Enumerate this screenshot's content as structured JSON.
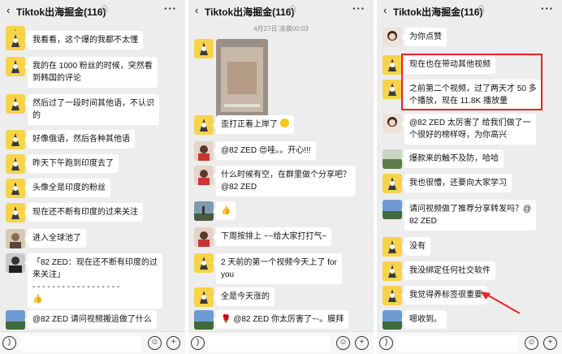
{
  "colors": {
    "bubble": "#ffffff",
    "chat_bg": "#ededed",
    "highlight": "#e8232b"
  },
  "screens": [
    {
      "title": "Tiktok出海掘金(116)",
      "messages": [
        {
          "text": ""
        },
        {
          "text": "我看看，这个爆的我都不太懂"
        },
        {
          "text": "我的在 1000 粉丝的时候，突然看\n到韩国的评论"
        },
        {
          "text": "然后过了一段时间其他语，不认识\n的"
        },
        {
          "text": "好像俄语，然后各种其他语"
        },
        {
          "text": "昨天下午跑到印度去了"
        },
        {
          "text": "头像全是印度的粉丝"
        },
        {
          "text": "现在还不断有印度的过来关注"
        },
        {
          "text": "进入全球池了"
        },
        {
          "text": "「82 ZED：现在还不断有印度的过\n来关注」\n- - - - - - - - - - - - - - - - - -\n👍"
        },
        {
          "text": "@82 ZED 请问视频搬运做了什么"
        }
      ]
    },
    {
      "title": "Tiktok出海掘金(116)",
      "timestamp": "4月27日 凌晨00:03",
      "messages": [
        {
          "text": "歪打正着上岸了"
        },
        {
          "text": "@82 ZED 😍哇。。开心!!!"
        },
        {
          "text": "什么时候有空，在群里做个分享吧？\n@82 ZED"
        },
        {
          "text": "👍"
        },
        {
          "text": "下周按排上 ~~给大家打打气~"
        },
        {
          "text": "2 天前的第一个视频今天上了 for\nyou"
        },
        {
          "text": "全是今天涨的"
        },
        {
          "text": "🌹 @82 ZED 你太厉害了~-。膜拜"
        }
      ]
    },
    {
      "title": "Tiktok出海掘金(116)",
      "messages": [
        {
          "text": "为你点赞"
        },
        {
          "text": "现在也在带动其他视频"
        },
        {
          "text": "之前第二个视频，过了两天才 50 多\n个播放，现在 11.8K 播放量"
        },
        {
          "text": "@82 ZED 太厉害了 给我们做了一\n个很好的榜样呀，为你高兴"
        },
        {
          "text": "爆款来的触不及防，哈哈"
        },
        {
          "text": "我也很懵，还要向大家学习"
        },
        {
          "text": "请问视频做了推荐分享转发吗？@\n82 ZED"
        },
        {
          "text": "没有"
        },
        {
          "text": "我没绑定任何社交软件"
        },
        {
          "text": "我觉得养标签很重要"
        },
        {
          "text": "嗯收到。"
        }
      ]
    }
  ],
  "icons": {
    "voice": "voice-icon",
    "emoji": "emoji-icon",
    "plus": "plus-icon",
    "back": "back-arrow-icon",
    "more": "more-icon"
  }
}
